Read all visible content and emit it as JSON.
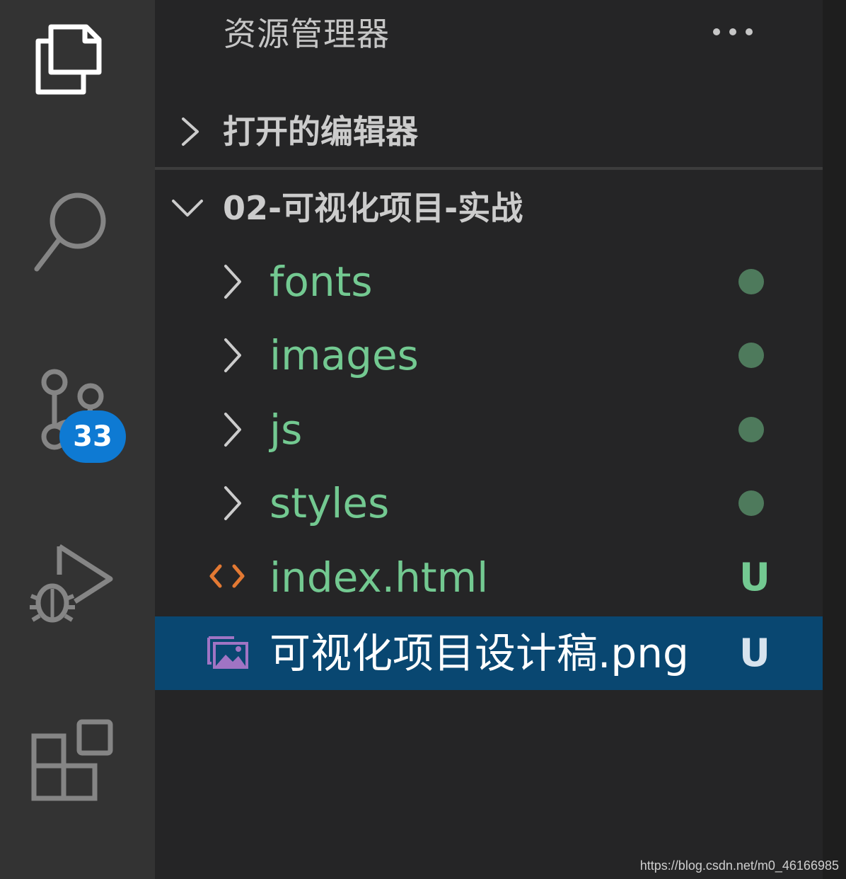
{
  "activity_bar": {
    "items": [
      {
        "icon": "files-icon",
        "active": true
      },
      {
        "icon": "search-icon",
        "active": false
      },
      {
        "icon": "source-control-icon",
        "active": false,
        "badge": "33"
      },
      {
        "icon": "run-debug-icon",
        "active": false
      },
      {
        "icon": "extensions-icon",
        "active": false
      }
    ]
  },
  "explorer": {
    "title": "资源管理器",
    "more_actions_icon": "ellipsis-icon",
    "open_editors": {
      "label": "打开的编辑器",
      "expanded": false
    },
    "workspace": {
      "label": "02-可视化项目-实战",
      "expanded": true
    },
    "items": [
      {
        "name": "fonts",
        "type": "folder",
        "status": "dot"
      },
      {
        "name": "images",
        "type": "folder",
        "status": "dot"
      },
      {
        "name": "js",
        "type": "folder",
        "status": "dot"
      },
      {
        "name": "styles",
        "type": "folder",
        "status": "dot"
      },
      {
        "name": "index.html",
        "type": "html-file",
        "status": "U"
      },
      {
        "name": "可视化项目设计稿.png",
        "type": "image-file",
        "status": "U",
        "selected": true
      }
    ]
  },
  "colors": {
    "activity_bg": "#333333",
    "sidebar_bg": "#252526",
    "selection_bg": "#094771",
    "untracked_green": "#73c991",
    "badge_blue": "#0e7ad3",
    "html_icon": "#e37933",
    "image_icon": "#a074c4"
  },
  "watermark": "https://blog.csdn.net/m0_46166985"
}
